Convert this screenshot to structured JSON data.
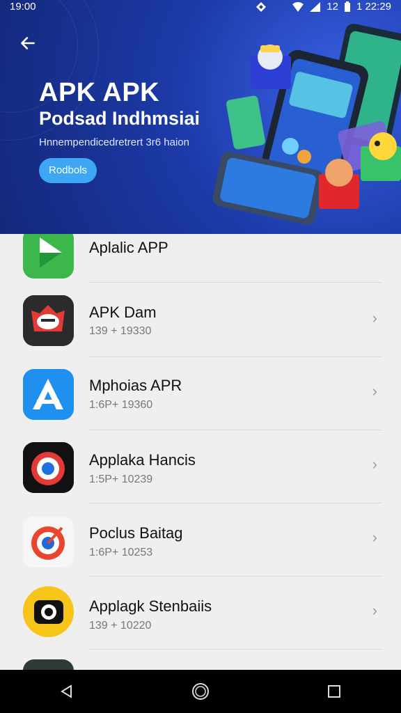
{
  "status_bar": {
    "time": "19:00",
    "battery_text": "12",
    "clock_right": "1 22:29"
  },
  "hero": {
    "title": "APK APK",
    "subtitle": "Podsad Indhmsiai",
    "description": "Hnnempendicedretrert 3r6 haion",
    "button_label": "Rodbols"
  },
  "apps": [
    {
      "name": "Aplalic APP",
      "meta": ""
    },
    {
      "name": "APK Dam",
      "meta": "139 + 19330"
    },
    {
      "name": "Mphoias APR",
      "meta": "1:6P+ 19360"
    },
    {
      "name": "Applaka Hancis",
      "meta": "1:5P+ 10239"
    },
    {
      "name": "Poclus Baitag",
      "meta": "1:6P+ 10253"
    },
    {
      "name": "Applagk Stenbaiis",
      "meta": "139 + 10220"
    },
    {
      "name": "",
      "meta": ""
    }
  ],
  "icons": {
    "back": "arrow-left-icon",
    "chevron": "chevron-right-icon",
    "nav_back": "triangle-back-icon",
    "nav_home": "circle-home-icon",
    "nav_recents": "square-recents-icon"
  },
  "colors": {
    "hero_bg": "#1c3aa8",
    "button": "#3ea7f5",
    "list_bg": "#efefef"
  }
}
